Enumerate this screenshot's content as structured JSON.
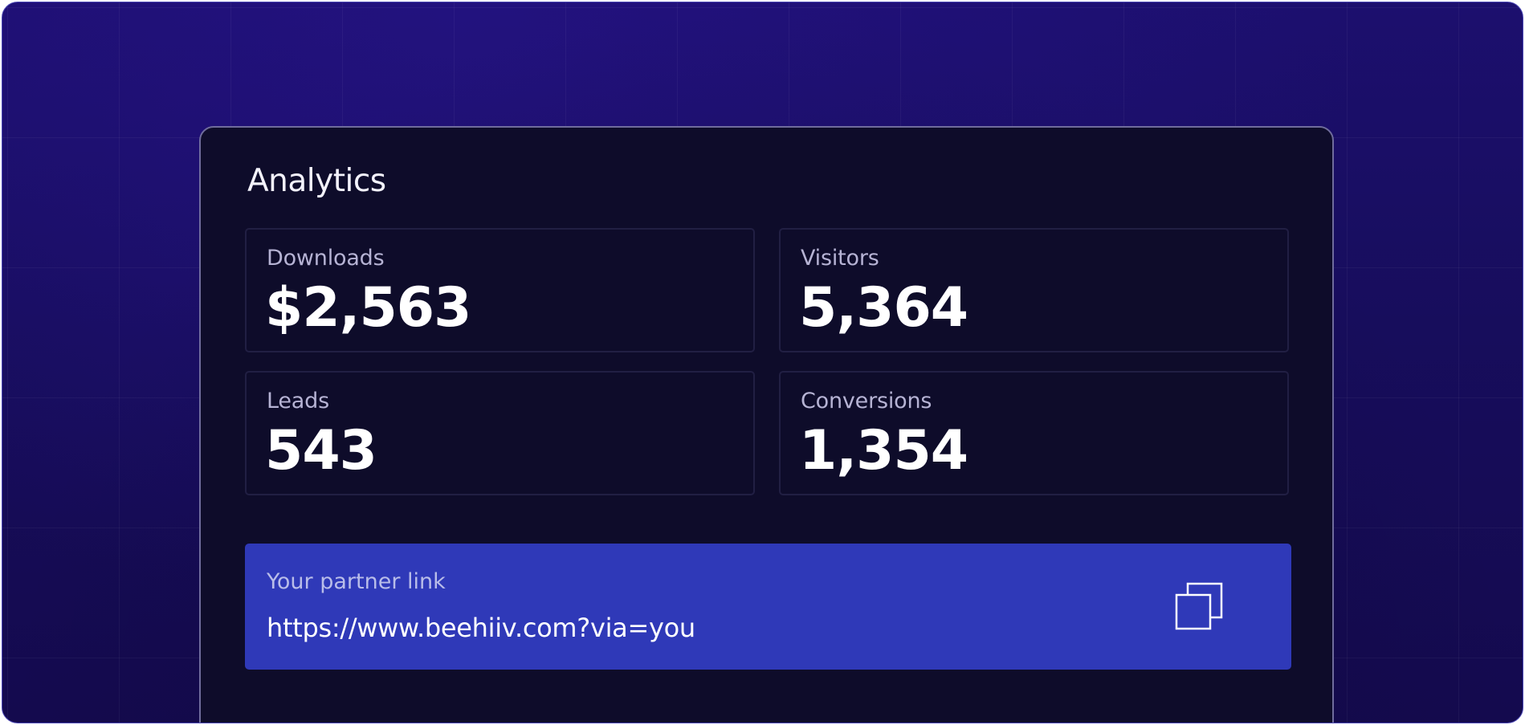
{
  "panel": {
    "title": "Analytics"
  },
  "stats": [
    {
      "label": "Downloads",
      "value": "$2,563"
    },
    {
      "label": "Visitors",
      "value": "5,364"
    },
    {
      "label": "Leads",
      "value": "543"
    },
    {
      "label": "Conversions",
      "value": "1,354"
    }
  ],
  "partner": {
    "label": "Your partner link",
    "url": "https://www.beehiiv.com?via=you",
    "copy_icon": "copy-icon"
  },
  "colors": {
    "background": "#170d5c",
    "panel": "#0e0c2a",
    "accent": "#2f39b8"
  }
}
